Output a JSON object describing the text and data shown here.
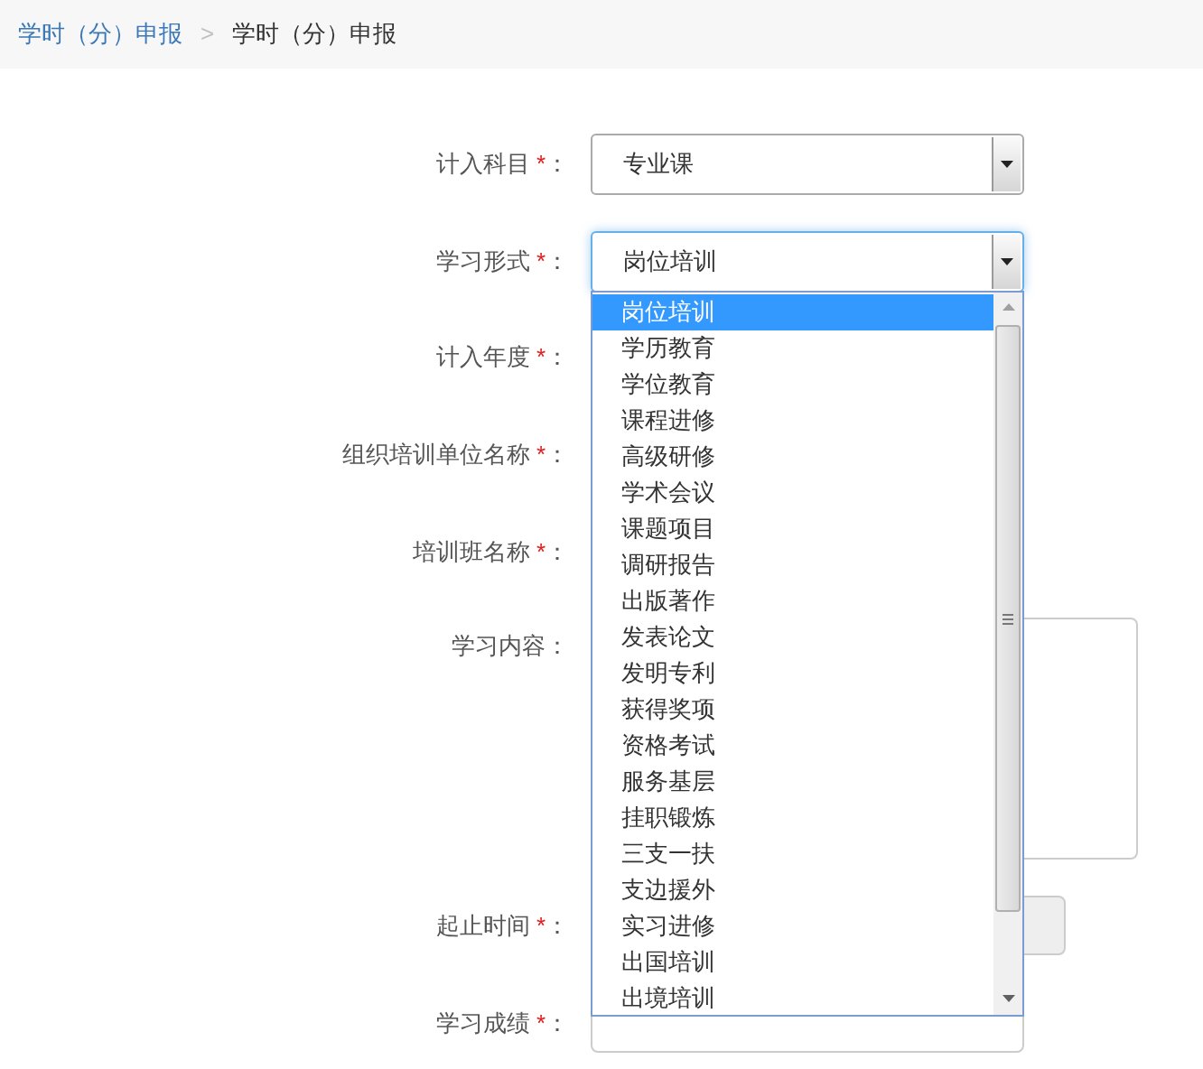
{
  "breadcrumb": [
    {
      "label": "学时（分）申报",
      "kind": "link"
    },
    {
      "label": ">",
      "kind": "separator"
    },
    {
      "label": "学时（分）申报",
      "kind": "current"
    }
  ],
  "form": {
    "fields": [
      {
        "label": "计入科目",
        "mark": "*",
        "suffix": "：",
        "kind": "select",
        "value": "专业课",
        "focused": false
      },
      {
        "label": "学习形式",
        "mark": "*",
        "suffix": "：",
        "kind": "select",
        "value": "岗位培训",
        "focused": true
      },
      {
        "label": "计入年度",
        "mark": "*",
        "suffix": "：",
        "kind": "covered"
      },
      {
        "label": "组织培训单位名称",
        "mark": "*",
        "suffix": "：",
        "kind": "covered"
      },
      {
        "label": "培训班名称",
        "mark": "*",
        "suffix": "：",
        "kind": "covered"
      },
      {
        "label": "学习内容",
        "suffix": "：",
        "kind": "textarea"
      },
      {
        "label": "起止时间",
        "mark": "*",
        "suffix": "：",
        "kind": "date_range"
      },
      {
        "label": "学习成绩",
        "mark": "*",
        "suffix": "：",
        "kind": "input"
      }
    ]
  },
  "dropdown": {
    "options": [
      {
        "label": "岗位培训",
        "selected": true
      },
      {
        "label": "学历教育",
        "selected": false
      },
      {
        "label": "学位教育",
        "selected": false
      },
      {
        "label": "课程进修",
        "selected": false
      },
      {
        "label": "高级研修",
        "selected": false
      },
      {
        "label": "学术会议",
        "selected": false
      },
      {
        "label": "课题项目",
        "selected": false
      },
      {
        "label": "调研报告",
        "selected": false
      },
      {
        "label": "出版著作",
        "selected": false
      },
      {
        "label": "发表论文",
        "selected": false
      },
      {
        "label": "发明专利",
        "selected": false
      },
      {
        "label": "获得奖项",
        "selected": false
      },
      {
        "label": "资格考试",
        "selected": false
      },
      {
        "label": "服务基层",
        "selected": false
      },
      {
        "label": "挂职锻炼",
        "selected": false
      },
      {
        "label": "三支一扶",
        "selected": false
      },
      {
        "label": "支边援外",
        "selected": false
      },
      {
        "label": "实习进修",
        "selected": false
      },
      {
        "label": "出国培训",
        "selected": false
      },
      {
        "label": "出境培训",
        "selected": false
      }
    ]
  }
}
